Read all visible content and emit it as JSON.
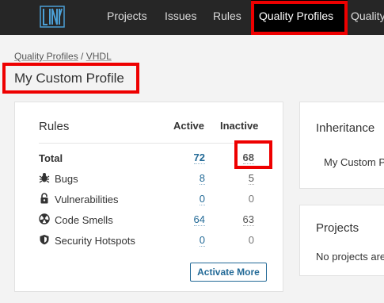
{
  "nav": {
    "logo_icon": "linty-logo-icon",
    "items": [
      {
        "label": "Projects"
      },
      {
        "label": "Issues"
      },
      {
        "label": "Rules"
      },
      {
        "label": "Quality Profiles"
      },
      {
        "label": "Quality"
      }
    ],
    "active_index": 3
  },
  "breadcrumb": {
    "parent": "Quality Profiles",
    "separator": "/",
    "language": "VHDL"
  },
  "page_title": "My Custom Profile",
  "rules_card": {
    "title": "Rules",
    "col_active": "Active",
    "col_inactive": "Inactive",
    "rows": [
      {
        "label": "Total",
        "icon": "",
        "active": "72",
        "inactive": "68"
      },
      {
        "label": "Bugs",
        "icon": "bug-icon",
        "active": "8",
        "inactive": "5"
      },
      {
        "label": "Vulnerabilities",
        "icon": "lock-icon",
        "active": "0",
        "inactive": "0"
      },
      {
        "label": "Code Smells",
        "icon": "code-smell-icon",
        "active": "64",
        "inactive": "63"
      },
      {
        "label": "Security Hotspots",
        "icon": "shield-icon",
        "active": "0",
        "inactive": "0"
      }
    ],
    "activate_button": "Activate More"
  },
  "inheritance_card": {
    "title": "Inheritance",
    "profile": "My Custom P"
  },
  "projects_card": {
    "title": "Projects",
    "text": "No projects are"
  },
  "colors": {
    "nav_bg": "#262626",
    "link": "#236a97",
    "highlight": "#ee0000"
  }
}
